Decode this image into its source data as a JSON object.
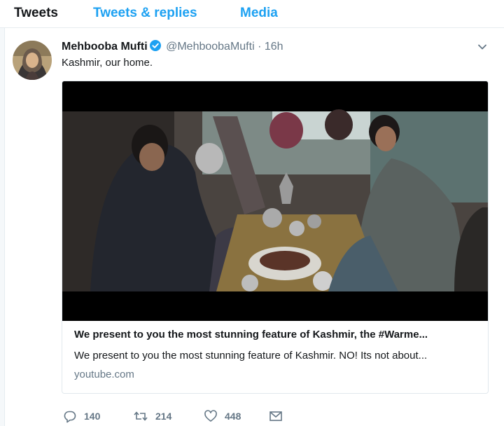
{
  "tabs": [
    {
      "label": "Tweets"
    },
    {
      "label": "Tweets & replies"
    },
    {
      "label": "Media"
    }
  ],
  "tweet": {
    "display_name": "Mehbooba Mufti",
    "handle": "@MehboobaMufti",
    "separator": "·",
    "time": "16h",
    "text": "Kashmir, our home.",
    "card": {
      "title": "We present to you the most stunning feature of Kashmir, the #Warme...",
      "description": "We present to you the most stunning feature of Kashmir. NO! Its not about...",
      "domain": "youtube.com"
    },
    "actions": {
      "replies": "140",
      "retweets": "214",
      "likes": "448"
    }
  },
  "colors": {
    "accent": "#1da1f2",
    "text": "#14171a",
    "muted": "#657786",
    "border": "#e6ecf0"
  },
  "icons": [
    "verified-badge-icon",
    "chevron-down-icon",
    "reply-icon",
    "retweet-icon",
    "heart-icon",
    "envelope-icon"
  ]
}
